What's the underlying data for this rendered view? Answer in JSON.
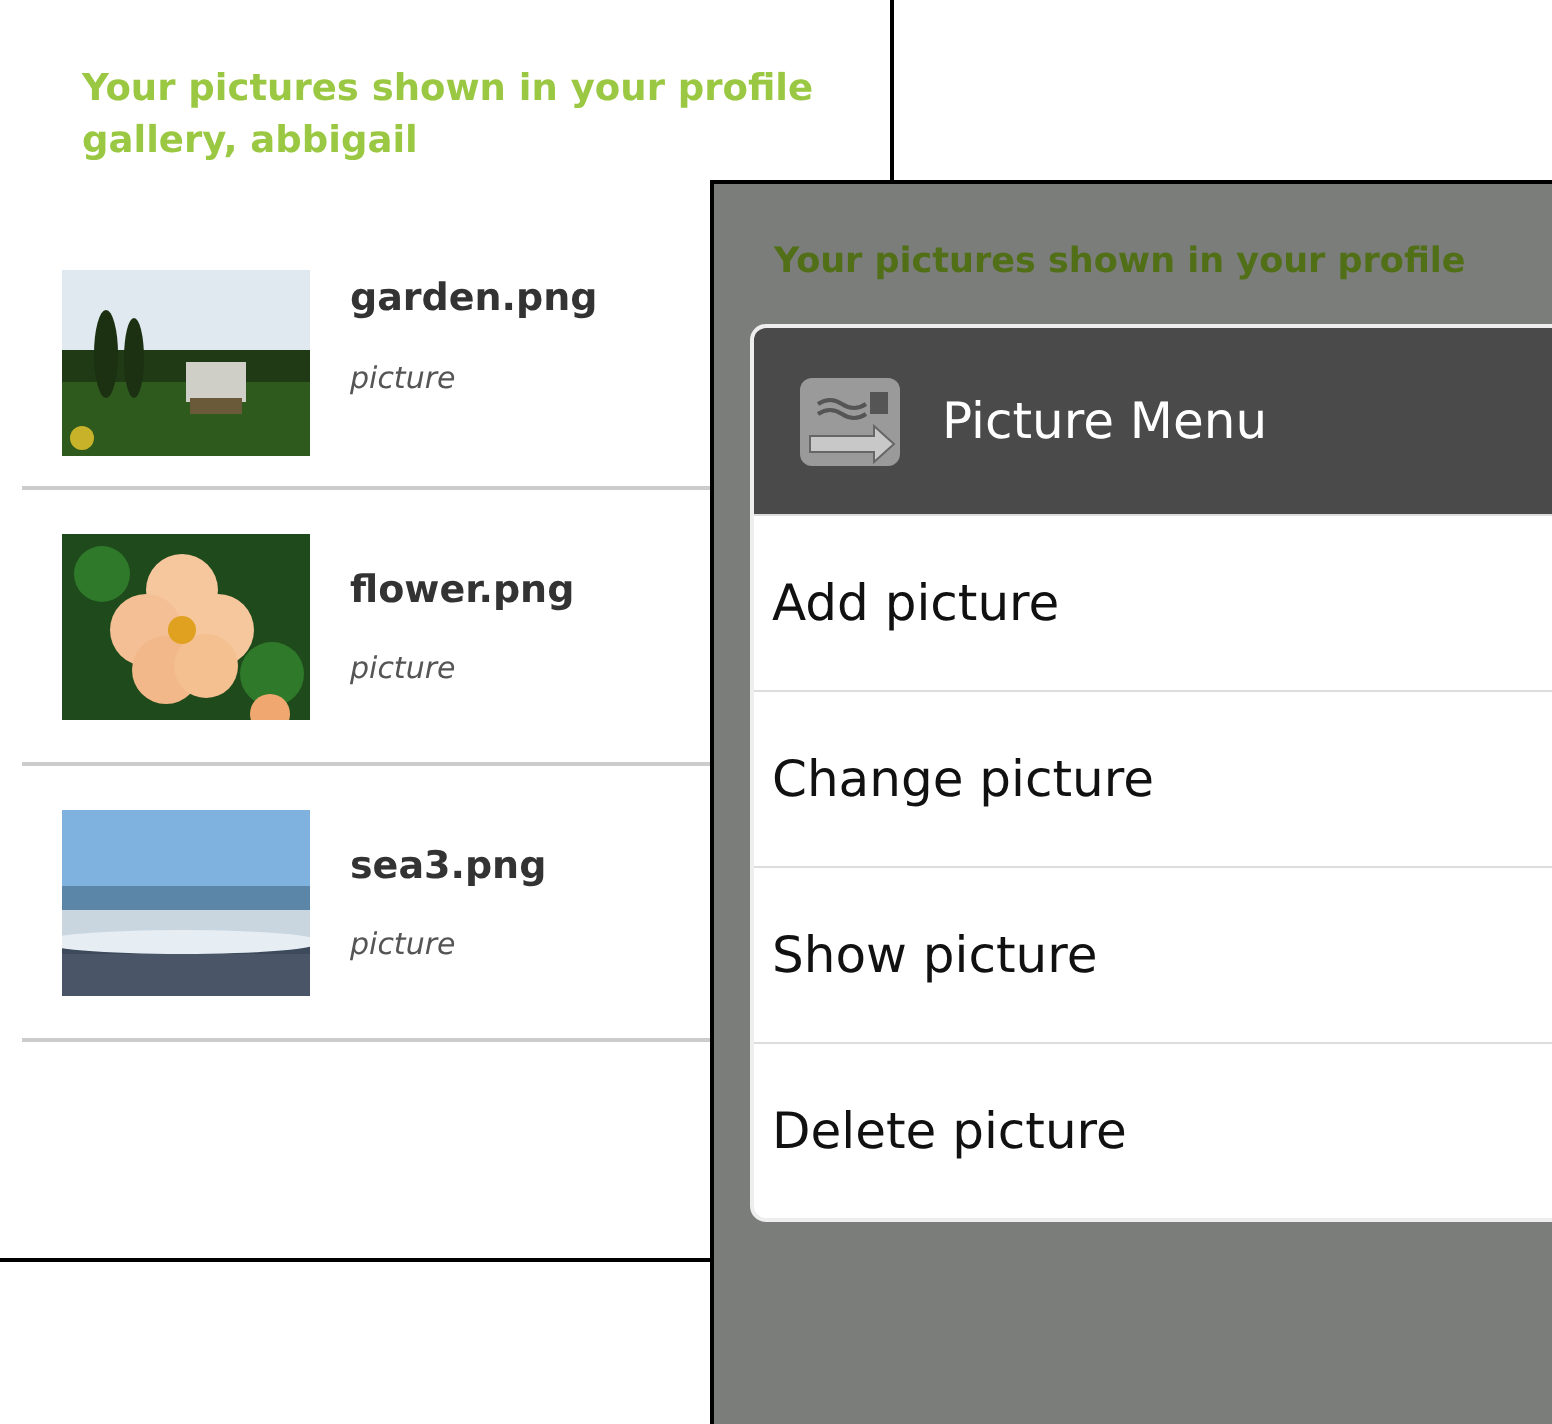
{
  "profile_screen": {
    "heading": "Your pictures shown in your profile gallery, abbigail",
    "pictures": [
      {
        "name": "garden.png",
        "caption": "picture"
      },
      {
        "name": "flower.png",
        "caption": "picture"
      },
      {
        "name": "sea3.png",
        "caption": "picture"
      }
    ]
  },
  "menu_screen": {
    "background_heading": "Your pictures shown in your profile",
    "dialog": {
      "title": "Picture Menu",
      "items": [
        "Add picture",
        "Change picture",
        "Show picture",
        "Delete picture"
      ]
    }
  }
}
